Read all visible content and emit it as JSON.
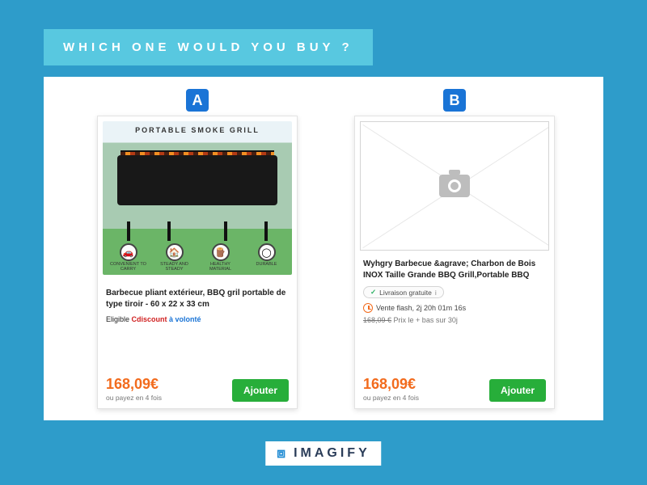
{
  "title": "WHICH ONE WOULD YOU BUY ?",
  "labels": {
    "a": "A",
    "b": "B"
  },
  "featureIcons": {
    "car": "🚗",
    "house": "🏠",
    "log": "🪵",
    "durable": "◯"
  },
  "productA": {
    "portableLabel": "PORTABLE SMOKE GRILL",
    "features": {
      "f1": "CONVENIENT TO CARRY",
      "f2": "STEADY AND STEADY",
      "f3": "HEALTHY MATERIAL",
      "f4": "DURABLE"
    },
    "name": "Barbecue pliant extérieur, BBQ gril portable de type tiroir - 60 x 22 x 33 cm",
    "eligiblePrefix": "Eligible ",
    "eligibleBrand": "Cdiscount",
    "eligibleSuffix": " à volonté",
    "price": "168,09€",
    "pay4": "ou payez en 4 fois",
    "addLabel": "Ajouter"
  },
  "productB": {
    "name": "Wyhgry Barbecue &agrave; Charbon de Bois INOX Taille Grande BBQ Grill,Portable BBQ",
    "chip": {
      "tick": "✓",
      "text": "Livraison gratuite",
      "info": "i"
    },
    "flash": "Vente flash, 2j 20h 01m 16s",
    "oldPrice": "168,09 €",
    "oldPriceNote": " Prix le + bas sur 30j",
    "price": "168,09€",
    "pay4": "ou payez en 4 fois",
    "addLabel": "Ajouter"
  },
  "footer": {
    "brand": "IMAGIFY"
  }
}
